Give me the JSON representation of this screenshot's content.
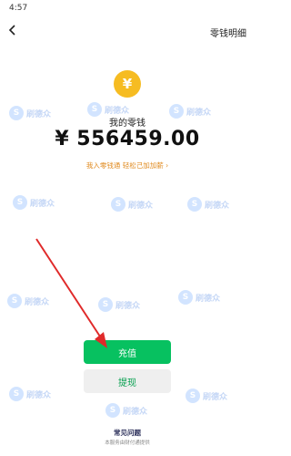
{
  "status_bar": {
    "time": "4:57"
  },
  "header": {
    "link_label": "零钱明细"
  },
  "wallet": {
    "coin_symbol": "¥",
    "label": "我的零钱",
    "amount": "¥ 556459.00",
    "note": "我入零钱通 轻松己加加薪 ›"
  },
  "actions": {
    "primary_label": "充值",
    "secondary_label": "提现"
  },
  "footer": {
    "faq_title": "常见问题",
    "faq_sub": "本服务由财付通提供"
  },
  "colors": {
    "accent": "#07c160",
    "warning": "#e08a1e",
    "coin": "#f6bc22",
    "arrow": "#e02a2a"
  },
  "watermark": {
    "logo": "S",
    "text": "刷德众"
  }
}
